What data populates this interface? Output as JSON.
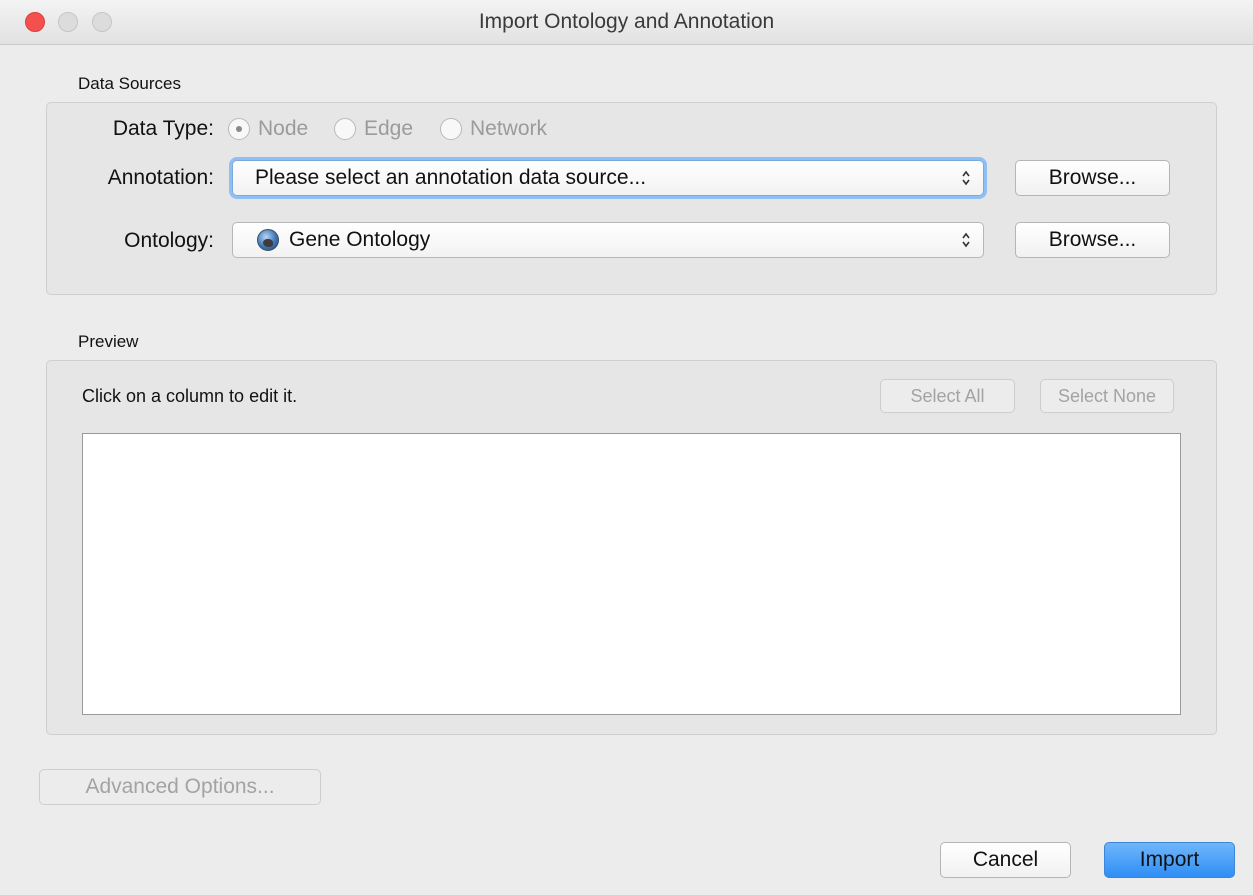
{
  "window": {
    "title": "Import Ontology and Annotation"
  },
  "data_sources": {
    "label": "Data Sources",
    "data_type": {
      "label": "Data Type:",
      "options": [
        "Node",
        "Edge",
        "Network"
      ],
      "selected": "Node"
    },
    "annotation": {
      "label": "Annotation:",
      "value": "Please select an annotation data source...",
      "browse_label": "Browse..."
    },
    "ontology": {
      "label": "Ontology:",
      "value": "Gene Ontology",
      "icon": "globe-icon",
      "browse_label": "Browse..."
    }
  },
  "preview": {
    "label": "Preview",
    "hint": "Click on a column to edit it.",
    "select_all_label": "Select All",
    "select_none_label": "Select None"
  },
  "footer": {
    "advanced_label": "Advanced Options...",
    "cancel_label": "Cancel",
    "import_label": "Import"
  },
  "colors": {
    "close_button": "#f4514e",
    "focus_ring": "#8fbff3",
    "primary_button": "#2f8ef5"
  }
}
